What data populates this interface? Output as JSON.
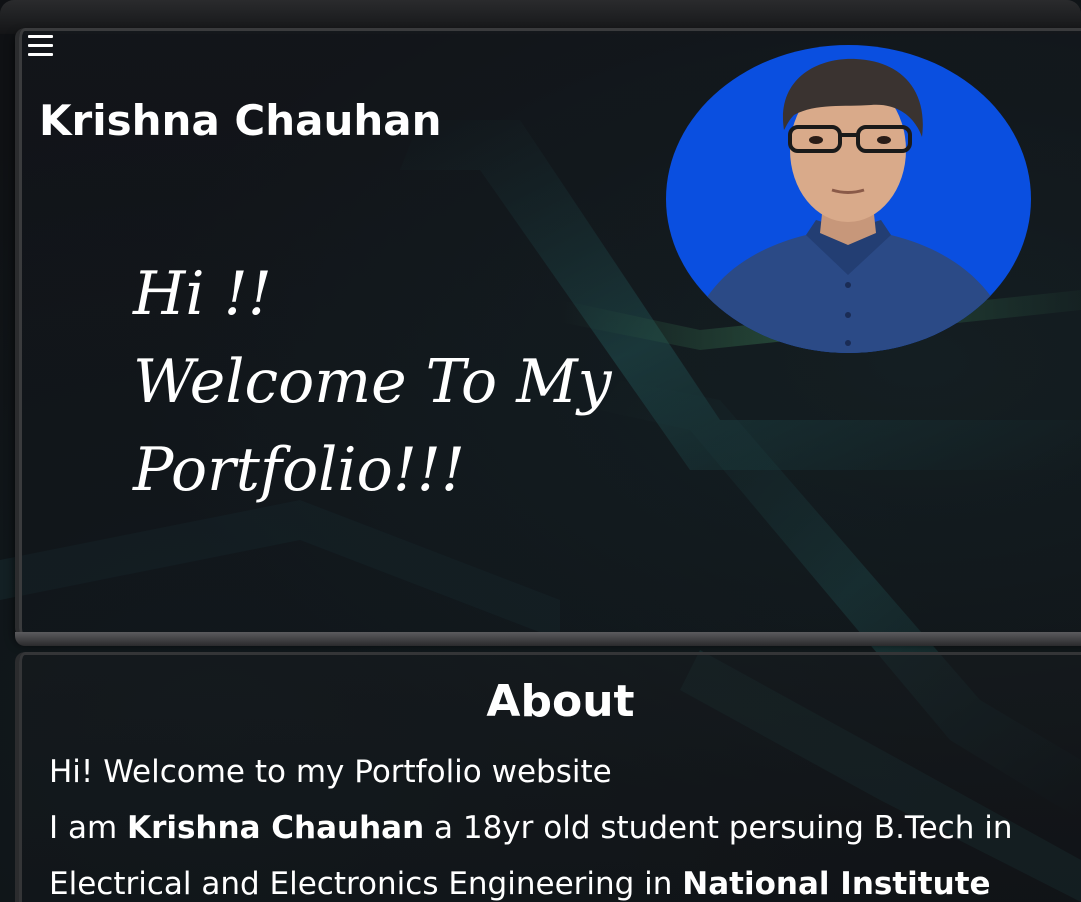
{
  "header": {
    "menu_icon": "hamburger-menu-icon",
    "site_name": "Krishna Chauhan"
  },
  "hero": {
    "greeting_line1": "Hi !!",
    "greeting_line2": "Welcome To My",
    "greeting_line3": "Portfolio!!!",
    "avatar_bg_color": "#0a4fe0"
  },
  "about": {
    "title": "About",
    "line1": "Hi! Welcome to my Portfolio website",
    "line2_prefix": "I am ",
    "line2_name": "Krishna Chauhan",
    "line2_suffix": " a 18yr old student persuing B.Tech in",
    "line3_prefix": "Electrical and Electronics Engineering in ",
    "line3_institute": "National Institute"
  },
  "colors": {
    "background": "#0f1114",
    "text": "#ffffff",
    "accent_teal": "#1e6b6b",
    "accent_green": "#3a8a5a"
  }
}
